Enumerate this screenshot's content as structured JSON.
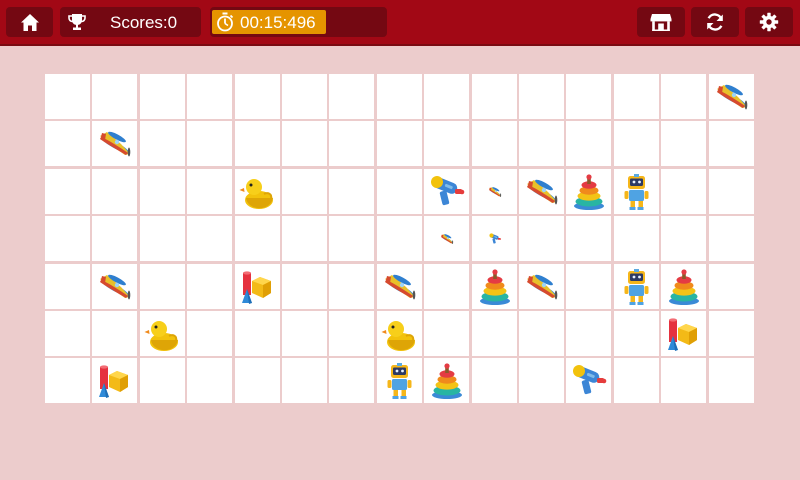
{
  "topbar": {
    "home_icon": "home-icon",
    "trophy_icon": "trophy-icon",
    "scores_label": "Scores:0",
    "stopwatch_icon": "stopwatch-icon",
    "timer": "00:15:496",
    "timer_progress": 0.66,
    "shop_icon": "shop-icon",
    "refresh_icon": "refresh-icon",
    "settings_icon": "gear-icon"
  },
  "colors": {
    "topbar": "#a20815",
    "button": "#740812",
    "timer_fill": "#e59400",
    "background": "#eccccc",
    "cell": "#ffffff"
  },
  "board": {
    "rows": 7,
    "cols": 15,
    "tiles": [
      {
        "row": 0,
        "col": 14,
        "toy": "airplane"
      },
      {
        "row": 1,
        "col": 1,
        "toy": "airplane"
      },
      {
        "row": 2,
        "col": 4,
        "toy": "duck"
      },
      {
        "row": 2,
        "col": 8,
        "toy": "water-gun"
      },
      {
        "row": 2,
        "col": 9,
        "toy": "airplane-small"
      },
      {
        "row": 2,
        "col": 10,
        "toy": "airplane"
      },
      {
        "row": 2,
        "col": 11,
        "toy": "stacking-rings"
      },
      {
        "row": 2,
        "col": 12,
        "toy": "robot"
      },
      {
        "row": 3,
        "col": 8,
        "toy": "airplane-small"
      },
      {
        "row": 3,
        "col": 9,
        "toy": "water-gun-small"
      },
      {
        "row": 4,
        "col": 1,
        "toy": "airplane"
      },
      {
        "row": 4,
        "col": 4,
        "toy": "blocks"
      },
      {
        "row": 4,
        "col": 7,
        "toy": "airplane"
      },
      {
        "row": 4,
        "col": 9,
        "toy": "stacking-rings"
      },
      {
        "row": 4,
        "col": 10,
        "toy": "airplane"
      },
      {
        "row": 4,
        "col": 12,
        "toy": "robot"
      },
      {
        "row": 4,
        "col": 13,
        "toy": "stacking-rings"
      },
      {
        "row": 5,
        "col": 2,
        "toy": "duck"
      },
      {
        "row": 5,
        "col": 7,
        "toy": "duck"
      },
      {
        "row": 5,
        "col": 13,
        "toy": "blocks"
      },
      {
        "row": 6,
        "col": 1,
        "toy": "blocks"
      },
      {
        "row": 6,
        "col": 7,
        "toy": "robot"
      },
      {
        "row": 6,
        "col": 8,
        "toy": "stacking-rings"
      },
      {
        "row": 6,
        "col": 11,
        "toy": "water-gun"
      }
    ]
  }
}
